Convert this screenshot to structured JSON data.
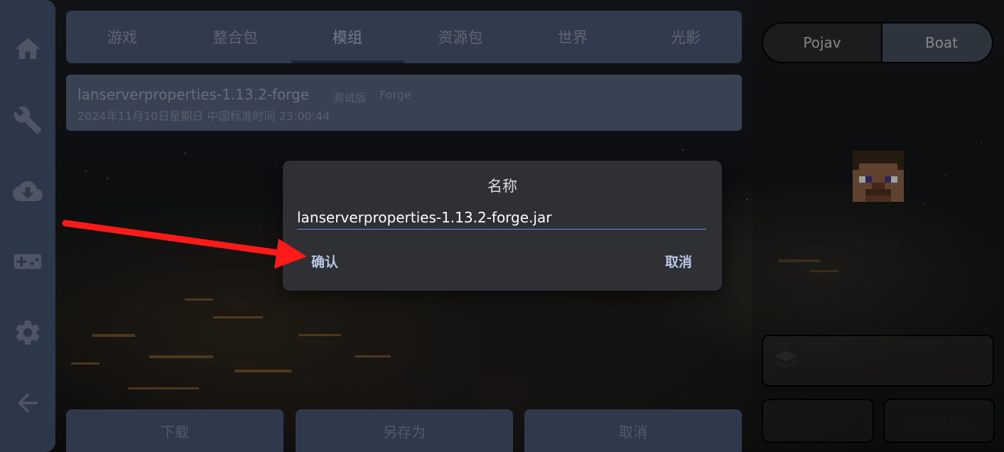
{
  "nav": {
    "items": [
      {
        "icon": "home-icon"
      },
      {
        "icon": "wrench-icon"
      },
      {
        "icon": "cloud-download-icon"
      },
      {
        "icon": "gamepad-icon"
      },
      {
        "icon": "gear-icon"
      },
      {
        "icon": "back-arrow-icon"
      }
    ]
  },
  "tabs": [
    {
      "label": "游戏"
    },
    {
      "label": "整合包"
    },
    {
      "label": "模组",
      "active": true
    },
    {
      "label": "资源包"
    },
    {
      "label": "世界"
    },
    {
      "label": "光影"
    }
  ],
  "mod_item": {
    "name": "lanserverproperties-1.13.2-forge",
    "tag_release": "测试版",
    "tag_loader": "Forge",
    "time": "2024年11月10日星期日 中国标准时间 23:00:44"
  },
  "bottom_buttons": {
    "download": "下载",
    "save_as": "另存为",
    "cancel": "取消"
  },
  "launcher_switch": {
    "option_1": "Pojav",
    "option_2": "Boat",
    "selected": "Boat"
  },
  "account": {
    "name": "2",
    "type": "离线账户"
  },
  "launch": {
    "label": "启动",
    "version": "1.21.4-Forge"
  },
  "right_buttons": {
    "manage_versions": "管理版本",
    "run_jar": "执行Jar文件"
  },
  "dialog": {
    "title": "名称",
    "input_value": "lanserverproperties-1.13.2-forge.jar",
    "confirm": "确认",
    "cancel": "取消"
  },
  "colors": {
    "nav_bg": "#4a5a78",
    "dialog_bg": "#2f3033",
    "accent": "#6b8fd0",
    "annotation_arrow": "#ff1a1a"
  }
}
